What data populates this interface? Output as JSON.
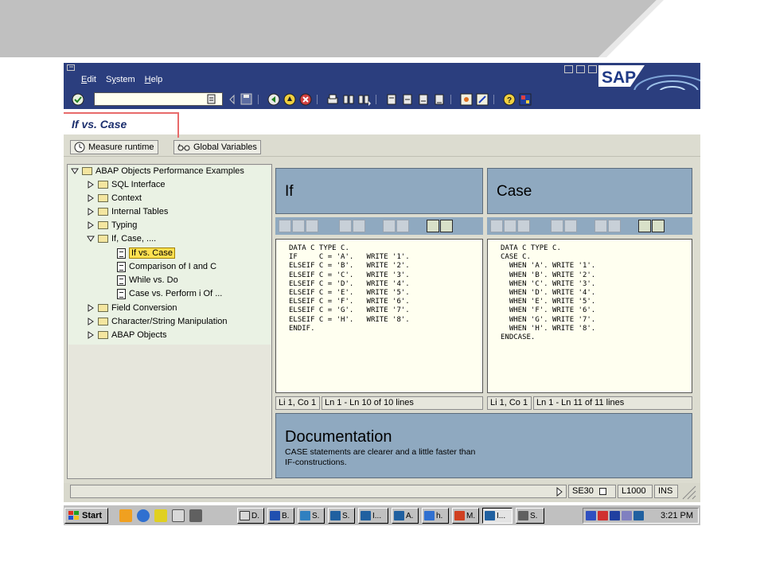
{
  "colors": {
    "sap_frame": "#2b3e7e",
    "editor_panel": "#8fa9c0",
    "code_background": "#fffff0",
    "title_text": "#1c2f6e",
    "highlight_box": "#e86a6a",
    "selected_node": "#ffe050"
  },
  "menu": [
    {
      "prefix": "",
      "hotkey": "E",
      "rest": "dit"
    },
    {
      "prefix": "S",
      "hotkey": "y",
      "rest": "stem"
    },
    {
      "prefix": "",
      "hotkey": "H",
      "rest": "elp"
    }
  ],
  "logo_text": "SAP",
  "toolbar_icons": [
    "enter-icon",
    "save-icon",
    "back-icon",
    "exit-icon",
    "cancel-icon",
    "print-icon",
    "find-icon",
    "find-next-icon",
    "first-page-icon",
    "previous-page-icon",
    "next-page-icon",
    "last-page-icon",
    "create-session-icon",
    "shortcut-icon",
    "help-icon",
    "layout-icon"
  ],
  "title": "If vs. Case",
  "app_toolbar": {
    "measure_runtime": "Measure runtime",
    "global_variables": "Global Variables"
  },
  "tree": {
    "root": "ABAP Objects Performance Examples",
    "items": [
      "SQL Interface",
      "Context",
      "Internal Tables",
      "Typing",
      "If, Case, ....",
      "If vs. Case",
      "Comparison of I and C",
      "While vs. Do",
      "Case vs. Perform i Of ...",
      "Field Conversion",
      "Character/String Manipulation",
      "ABAP Objects"
    ]
  },
  "left_editor": {
    "title": "If",
    "code": "DATA C TYPE C.\nIF     C = 'A'.   WRITE '1'.\nELSEIF C = 'B'.   WRITE '2'.\nELSEIF C = 'C'.   WRITE '3'.\nELSEIF C = 'D'.   WRITE '4'.\nELSEIF C = 'E'.   WRITE '5'.\nELSEIF C = 'F'.   WRITE '6'.\nELSEIF C = 'G'.   WRITE '7'.\nELSEIF C = 'H'.   WRITE '8'.\nENDIF.",
    "cursor": "Li 1, Co 1",
    "lines": "Ln 1 - Ln 10 of 10 lines"
  },
  "right_editor": {
    "title": "Case",
    "code": "DATA C TYPE C.\nCASE C.\n  WHEN 'A'. WRITE '1'.\n  WHEN 'B'. WRITE '2'.\n  WHEN 'C'. WRITE '3'.\n  WHEN 'D'. WRITE '4'.\n  WHEN 'E'. WRITE '5'.\n  WHEN 'F'. WRITE '6'.\n  WHEN 'G'. WRITE '7'.\n  WHEN 'H'. WRITE '8'.\nENDCASE.",
    "cursor": "Li 1, Co 1",
    "lines": "Ln 1 - Ln 11 of 11 lines"
  },
  "documentation": {
    "title": "Documentation",
    "text_line1": "CASE statements are clearer and a little faster than",
    "text_line2": "IF-constructions."
  },
  "status_bar": {
    "transaction": "SE30",
    "server": "L1000",
    "mode": "INS"
  },
  "taskbar": {
    "start": "Start",
    "tasks": [
      "D.",
      "B.",
      "S.",
      "S.",
      "I...",
      "A.",
      "h.",
      "M.",
      "I...",
      "S."
    ],
    "clock": "3:21 PM"
  }
}
